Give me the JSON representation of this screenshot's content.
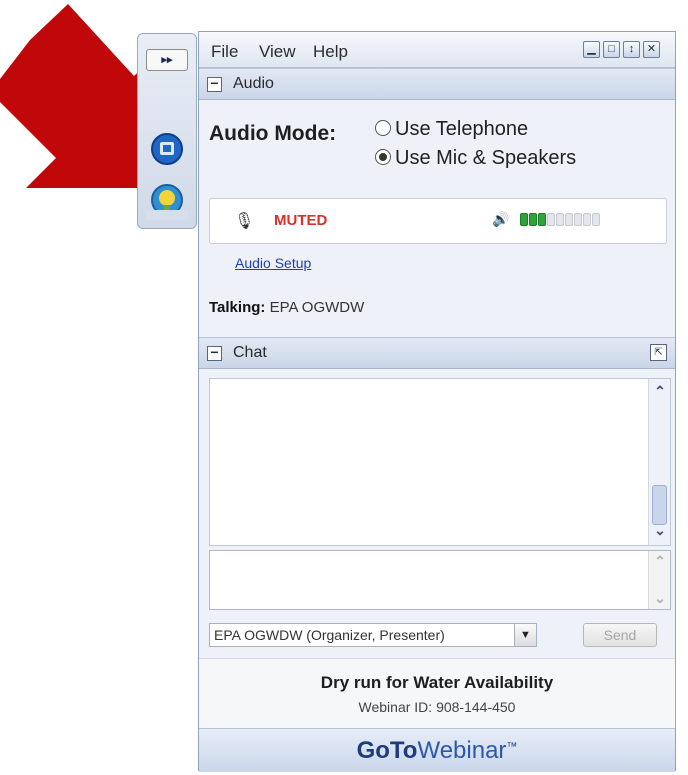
{
  "menu": {
    "file": "File",
    "view": "View",
    "help": "Help"
  },
  "window_controls": [
    "minimize-button",
    "restore-button",
    "pin-button",
    "close-button"
  ],
  "audio": {
    "section_title": "Audio",
    "mode_label": "Audio Mode:",
    "options": [
      {
        "label": "Use Telephone",
        "selected": false
      },
      {
        "label": "Use Mic & Speakers",
        "selected": true
      }
    ],
    "mic_status": "MUTED",
    "speaker_meter": {
      "level_bars": 3,
      "total_bars": 9
    },
    "setup_link": "Audio Setup",
    "talking_label": "Talking:",
    "talking_name": "EPA OGWDW"
  },
  "chat": {
    "section_title": "Chat",
    "input_value": "",
    "recipient": "EPA OGWDW (Organizer, Presenter)",
    "send_label": "Send"
  },
  "webinar": {
    "title": "Dry run for Water Availability",
    "id_text": "Webinar ID: 908-144-450"
  },
  "brand": {
    "goto": "GoTo",
    "webinar": "Webinar",
    "tm": "™"
  },
  "colors": {
    "muted_red": "#d9302a",
    "meter_green": "#2fa43a",
    "meter_empty": "#e3e6ea",
    "arrow_red": "#c0080b",
    "link_blue": "#1f3fb1"
  }
}
